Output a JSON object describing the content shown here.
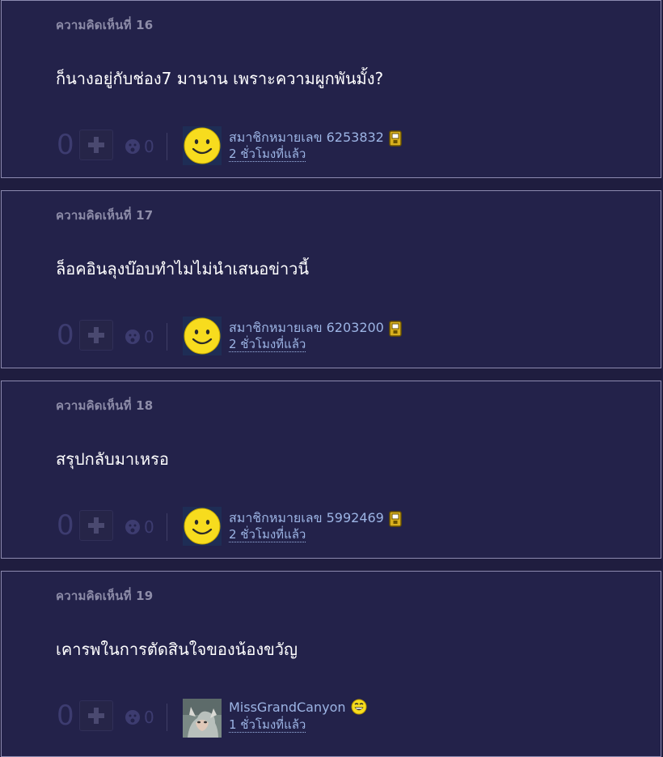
{
  "comments": [
    {
      "title": "ความคิดเห็นที่ 16",
      "body": "ก็นางอยู่กับช่อง7 มานาน เพราะความผูกพันมั้ง?",
      "votes": "0",
      "emotion_count": "0",
      "user": "สมาชิกหมายเลข 6253832",
      "time": "2 ชั่วโมงที่แล้ว",
      "avatar": "smiley-avatar",
      "user_badge": "mobile-icon"
    },
    {
      "title": "ความคิดเห็นที่ 17",
      "body": "ล็อคอินลุงบ๊อบทำไมไม่นำเสนอข่าวนี้",
      "votes": "0",
      "emotion_count": "0",
      "user": "สมาชิกหมายเลข 6203200",
      "time": "2 ชั่วโมงที่แล้ว",
      "avatar": "smiley-avatar",
      "user_badge": "mobile-icon"
    },
    {
      "title": "ความคิดเห็นที่ 18",
      "body": "สรุปกลับมาเหรอ",
      "votes": "0",
      "emotion_count": "0",
      "user": "สมาชิกหมายเลข 5992469",
      "time": "2 ชั่วโมงที่แล้ว",
      "avatar": "smiley-avatar",
      "user_badge": "mobile-icon"
    },
    {
      "title": "ความคิดเห็นที่ 19",
      "body": "เคารพในการตัดสินใจของน้องขวัญ",
      "votes": "0",
      "emotion_count": "0",
      "user": "MissGrandCanyon",
      "time": "1 ชั่วโมงที่แล้ว",
      "avatar": "photo-avatar",
      "user_badge": "laughing-emoji-icon"
    }
  ],
  "colors": {
    "page_bg": "#1f1d3f",
    "card_bg": "#23224a",
    "card_border": "#8c8ab0",
    "title": "#8d8ca8",
    "body_text": "#ffffff",
    "link": "#9cb4e4",
    "muted": "#3d3c70"
  }
}
